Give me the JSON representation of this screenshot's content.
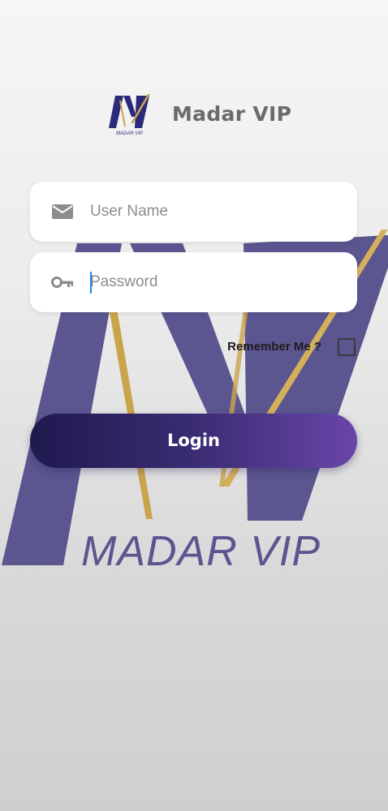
{
  "app": {
    "title": "Madar VIP",
    "logo_text": "MADAR VIP",
    "background_watermark_text": "MADAR VIP"
  },
  "form": {
    "username": {
      "placeholder": "User Name",
      "value": "",
      "icon": "mail-icon"
    },
    "password": {
      "placeholder": "Password",
      "value": "",
      "icon": "key-icon"
    },
    "remember_me": {
      "label": "Remember Me ?",
      "checked": false
    },
    "login_label": "Login"
  },
  "colors": {
    "brand_purple": "#5a548f",
    "gold": "#c9a44a",
    "button_gradient_start": "#1f1a4e",
    "button_gradient_end": "#6a45a8",
    "title_gray": "#6b6b6b"
  }
}
